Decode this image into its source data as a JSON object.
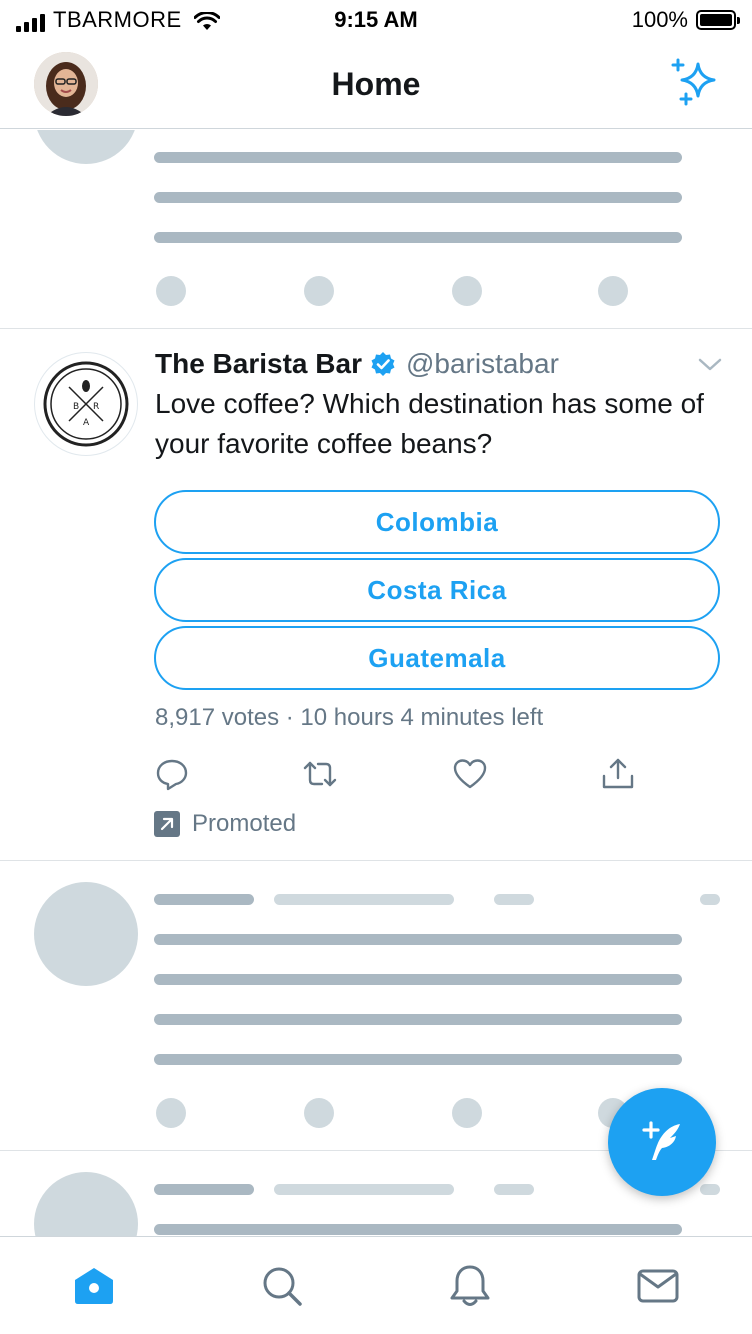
{
  "status_bar": {
    "carrier": "TBARMORE",
    "time": "9:15 AM",
    "battery": "100%"
  },
  "header": {
    "title": "Home",
    "avatar_icon": "profile-avatar",
    "right_icon": "sparkle-icon"
  },
  "tweet": {
    "name": "The Barista Bar",
    "handle": "@baristabar",
    "verified": true,
    "text": "Love coffee? Which destination has some of your favorite coffee beans?",
    "poll": {
      "options": [
        "Colombia",
        "Costa Rica",
        "Guatemala"
      ],
      "meta": "8,917 votes · 10 hours 4 minutes left"
    },
    "actions": [
      "reply-icon",
      "retweet-icon",
      "like-icon",
      "share-icon"
    ],
    "promoted_label": "Promoted"
  },
  "tab_bar": {
    "tabs": [
      "home-icon",
      "search-icon",
      "notifications-icon",
      "messages-icon"
    ],
    "active": "home-icon"
  },
  "colors": {
    "accent": "#1da1f2",
    "secondary_text": "#657786",
    "skeleton_dark": "#aab8c2",
    "skeleton_light": "#cfd9de"
  }
}
